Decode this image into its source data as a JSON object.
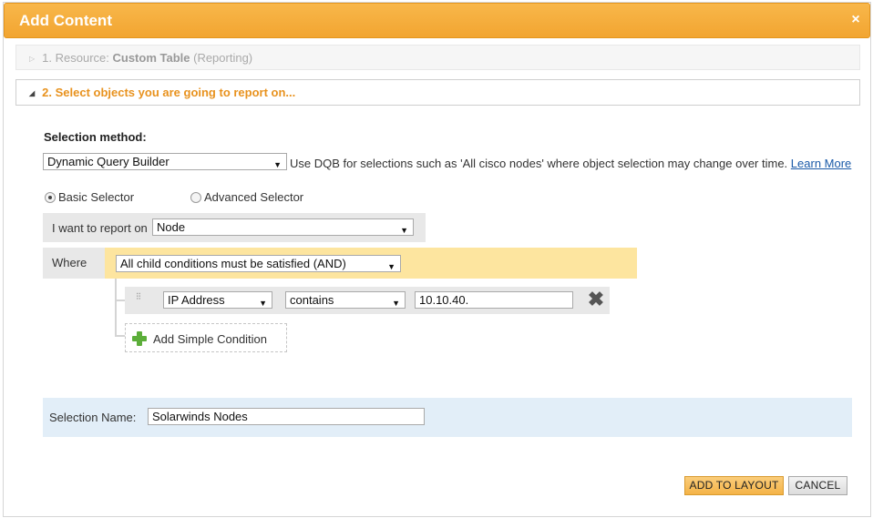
{
  "dialog": {
    "title": "Add Content",
    "close_glyph": "×"
  },
  "steps": [
    {
      "prefix": "1. Resource: ",
      "name": "Custom Table",
      "suffix": "(Reporting)"
    },
    {
      "label": "2. Select objects you are going to report on..."
    }
  ],
  "selection": {
    "method_label": "Selection method:",
    "method_value": "Dynamic Query Builder",
    "dqb_note": "Use DQB for selections such as 'All cisco nodes' where object selection may change over time.",
    "learn_more": "Learn More",
    "radios": [
      {
        "label": "Basic Selector",
        "selected": true
      },
      {
        "label": "Advanced Selector",
        "selected": false
      }
    ],
    "report_on_label": "I want to report on",
    "report_on_value": "Node",
    "where_label": "Where",
    "logic_value": "All child conditions must be satisfied (AND)",
    "condition": {
      "field": "IP Address",
      "operator": "contains",
      "value": "10.10.40."
    },
    "add_condition_label": "Add Simple Condition",
    "name_label": "Selection Name:",
    "name_value": "Solarwinds Nodes"
  },
  "buttons": {
    "add_to_layout": "ADD TO LAYOUT",
    "cancel": "CANCEL"
  },
  "colors": {
    "title_bar": "#f2a531",
    "step_active": "#e8921e",
    "and_bar": "#fde59f",
    "name_panel": "#e2eef8",
    "add_icon": "#5cae3a"
  },
  "icons": {
    "close": "close-icon",
    "collapsed_step": "triangle-right-icon",
    "expanded_step": "triangle-down-icon",
    "drag": "drag-handle-icon",
    "delete": "delete-x-icon",
    "add": "plus-icon"
  }
}
